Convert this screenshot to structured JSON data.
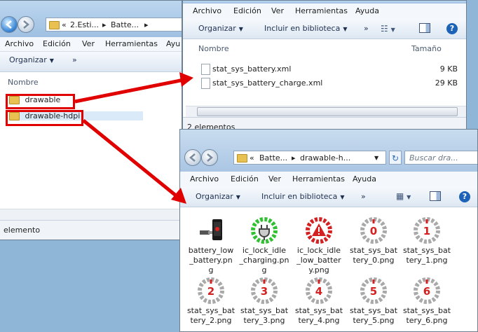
{
  "win_left": {
    "breadcrumb": [
      "«",
      "2.Esti...",
      "Batte..."
    ],
    "menu": [
      "Archivo",
      "Edición",
      "Ver",
      "Herramientas",
      "Ayu"
    ],
    "toolbar": {
      "organize": "Organizar",
      "more": "»"
    },
    "column": "Nombre",
    "items": [
      "drawable",
      "drawable-hdpi"
    ],
    "status": "elemento"
  },
  "win_top": {
    "menu": [
      "Archivo",
      "Edición",
      "Ver",
      "Herramientas",
      "Ayuda"
    ],
    "toolbar": {
      "organize": "Organizar",
      "include": "Incluir en biblioteca",
      "more": "»"
    },
    "columns": {
      "name": "Nombre",
      "size": "Tamaño"
    },
    "files": [
      {
        "name": "stat_sys_battery.xml",
        "size": "9 KB"
      },
      {
        "name": "stat_sys_battery_charge.xml",
        "size": "29 KB"
      }
    ],
    "status": "2 elementos"
  },
  "win_bottom": {
    "breadcrumb": [
      "«",
      "Batte...",
      "drawable-h..."
    ],
    "search_placeholder": "Buscar dra...",
    "menu": [
      "Archivo",
      "Edición",
      "Ver",
      "Herramientas",
      "Ayuda"
    ],
    "toolbar": {
      "organize": "Organizar",
      "include": "Incluir en biblioteca",
      "more": "»"
    },
    "tiles": [
      {
        "label": "battery_low_battery.png",
        "lines": [
          "battery_low",
          "_battery.pn",
          "g"
        ],
        "kind": "phone"
      },
      {
        "label": "ic_lock_idle_charging.png",
        "lines": [
          "ic_lock_idle",
          "_charging.pn",
          "g"
        ],
        "kind": "charge"
      },
      {
        "label": "ic_lock_idle_low_battery.png",
        "lines": [
          "ic_lock_idle",
          "_low_batter",
          "y.png"
        ],
        "kind": "warn"
      },
      {
        "label": "stat_sys_battery_0.png",
        "lines": [
          "stat_sys_bat",
          "tery_0.png"
        ],
        "kind": "num",
        "num": "0"
      },
      {
        "label": "stat_sys_battery_1.png",
        "lines": [
          "stat_sys_bat",
          "tery_1.png"
        ],
        "kind": "num",
        "num": "1"
      },
      {
        "label": "stat_sys_battery_2.png",
        "lines": [
          "stat_sys_bat",
          "tery_2.png"
        ],
        "kind": "num",
        "num": "2"
      },
      {
        "label": "stat_sys_battery_3.png",
        "lines": [
          "stat_sys_bat",
          "tery_3.png"
        ],
        "kind": "num",
        "num": "3"
      },
      {
        "label": "stat_sys_battery_4.png",
        "lines": [
          "stat_sys_bat",
          "tery_4.png"
        ],
        "kind": "num",
        "num": "4"
      },
      {
        "label": "stat_sys_battery_5.png",
        "lines": [
          "stat_sys_bat",
          "tery_5.png"
        ],
        "kind": "num",
        "num": "5"
      },
      {
        "label": "stat_sys_battery_6.png",
        "lines": [
          "stat_sys_bat",
          "tery_6.png"
        ],
        "kind": "num",
        "num": "6"
      }
    ]
  },
  "colors": {
    "accent_red": "#e00000",
    "folder": "#e8c150",
    "help": "#1c63b8"
  }
}
